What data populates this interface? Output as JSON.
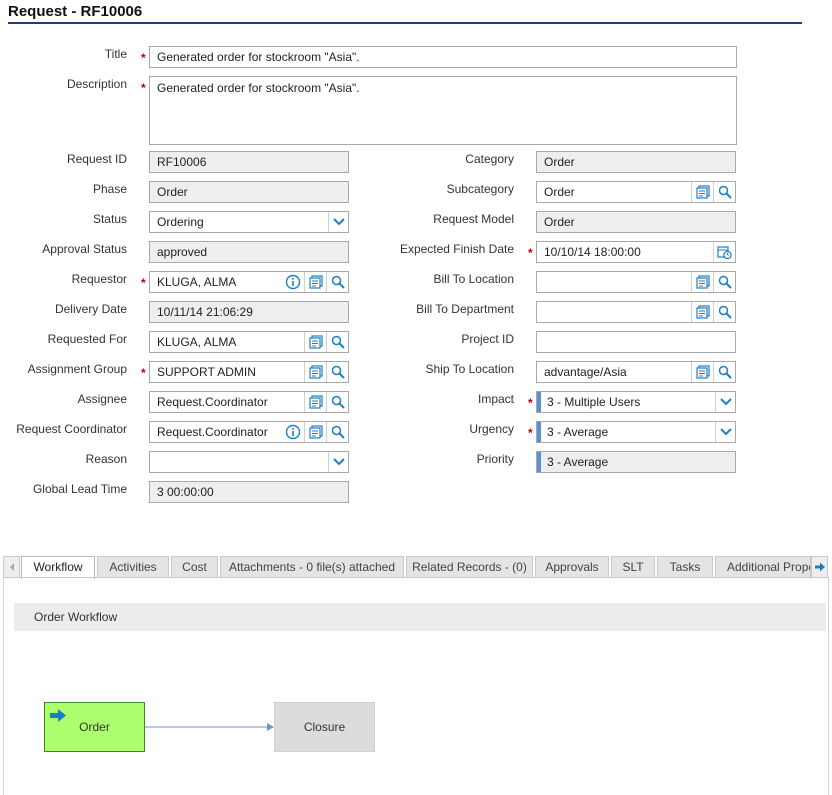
{
  "page": {
    "title": "Request - RF10006"
  },
  "form": {
    "title_label": "Title",
    "title_value": "Generated order for stockroom \"Asia\".",
    "description_label": "Description",
    "description_value": "Generated order for stockroom \"Asia\".",
    "request_id_label": "Request ID",
    "request_id_value": "RF10006",
    "phase_label": "Phase",
    "phase_value": "Order",
    "status_label": "Status",
    "status_value": "Ordering",
    "approval_status_label": "Approval Status",
    "approval_status_value": "approved",
    "requestor_label": "Requestor",
    "requestor_value": "KLUGA, ALMA",
    "delivery_date_label": "Delivery Date",
    "delivery_date_value": "10/11/14 21:06:29",
    "requested_for_label": "Requested For",
    "requested_for_value": "KLUGA, ALMA",
    "assignment_group_label": "Assignment Group",
    "assignment_group_value": "SUPPORT ADMIN",
    "assignee_label": "Assignee",
    "assignee_value": "Request.Coordinator",
    "request_coordinator_label": "Request Coordinator",
    "request_coordinator_value": "Request.Coordinator",
    "reason_label": "Reason",
    "reason_value": "",
    "global_lead_time_label": "Global Lead Time",
    "global_lead_time_value": "3 00:00:00",
    "category_label": "Category",
    "category_value": "Order",
    "subcategory_label": "Subcategory",
    "subcategory_value": "Order",
    "request_model_label": "Request Model",
    "request_model_value": "Order",
    "expected_finish_label": "Expected Finish Date",
    "expected_finish_value": "10/10/14 18:00:00",
    "bill_to_location_label": "Bill To Location",
    "bill_to_location_value": "",
    "bill_to_department_label": "Bill To Department",
    "bill_to_department_value": "",
    "project_id_label": "Project ID",
    "project_id_value": "",
    "ship_to_location_label": "Ship To Location",
    "ship_to_location_value": "advantage/Asia",
    "impact_label": "Impact",
    "impact_value": "3 - Multiple Users",
    "urgency_label": "Urgency",
    "urgency_value": "3 - Average",
    "priority_label": "Priority",
    "priority_value": "3 - Average",
    "required_marker": "*"
  },
  "tabs": [
    {
      "label": "Workflow",
      "active": true
    },
    {
      "label": "Activities"
    },
    {
      "label": "Cost"
    },
    {
      "label": "Attachments - 0 file(s) attached"
    },
    {
      "label": "Related Records - (0)"
    },
    {
      "label": "Approvals"
    },
    {
      "label": "SLT"
    },
    {
      "label": "Tasks"
    },
    {
      "label": "Additional Prope"
    }
  ],
  "workflow": {
    "header": "Order Workflow",
    "nodes": [
      {
        "label": "Order",
        "state": "current",
        "color": "#adff6e"
      },
      {
        "label": "Closure",
        "state": "pending",
        "color": "#dcdcdc"
      }
    ]
  },
  "colors": {
    "accent": "#1f3f6e",
    "required": "#c00000",
    "icon_blue": "#1b7fc4"
  }
}
